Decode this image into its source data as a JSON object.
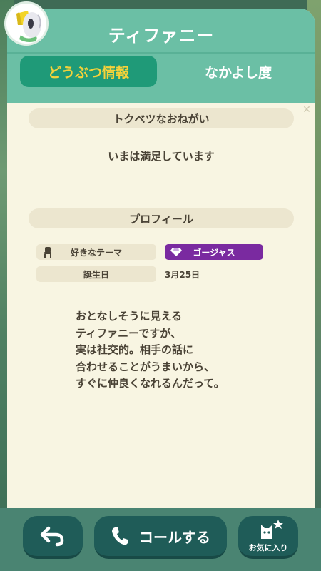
{
  "header": {
    "villager_name": "ティファニー",
    "avatar_icon": "villager-avatar-icon"
  },
  "tabs": [
    {
      "label": "どうぶつ情報",
      "active": true
    },
    {
      "label": "なかよし度",
      "active": false
    }
  ],
  "wish_section": {
    "title": "トクベツなおねがい",
    "text": "いまは満足しています"
  },
  "profile_section": {
    "title": "プロフィール",
    "favorite_theme": {
      "label": "好きなテーマ",
      "icon": "chair-icon",
      "value": "ゴージャス",
      "value_icon": "gem-icon"
    },
    "birthday": {
      "label": "誕生日",
      "value": "3月25日"
    }
  },
  "bio_lines": [
    "おとなしそうに見える",
    "ティファニーですが、",
    "実は社交的。相手の話に",
    "合わせることがうまいから、",
    "すぐに仲良くなれるんだって。"
  ],
  "footer": {
    "back_icon": "back-arrow-icon",
    "call_label": "コールする",
    "call_icon": "phone-icon",
    "favorite_label": "お気に入り",
    "favorite_icon": "cat-star-icon"
  },
  "colors": {
    "header_teal": "#6bbfa5",
    "active_tab": "#1f9a78",
    "active_tab_text": "#f5d23a",
    "card_bg": "#f8f5e2",
    "theme_badge": "#7a2aa0",
    "footer_button": "#1f5c58"
  }
}
